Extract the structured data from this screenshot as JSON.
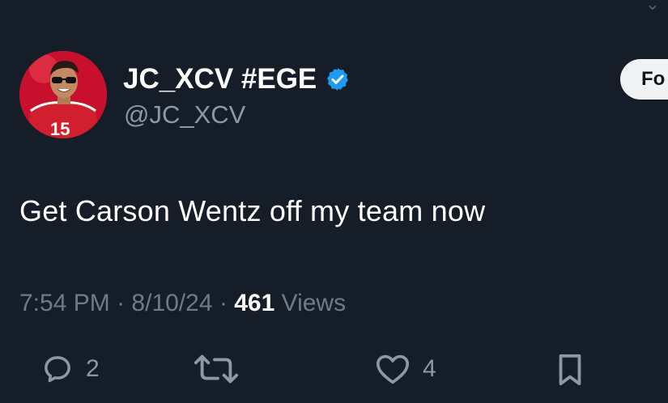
{
  "user": {
    "display_name": "JC_XCV #EGE",
    "handle": "@JC_XCV",
    "verified": true,
    "avatar_icon": "avatar-photo"
  },
  "follow_button": {
    "label": "Fo"
  },
  "tweet": {
    "text": "Get Carson Wentz off my team now"
  },
  "meta": {
    "time": "7:54 PM",
    "date": "8/10/24",
    "separator": "·",
    "views_count": "461",
    "views_label": "Views"
  },
  "actions": {
    "reply": {
      "icon": "reply-icon",
      "count": "2"
    },
    "retweet": {
      "icon": "retweet-icon",
      "count": ""
    },
    "like": {
      "icon": "heart-icon",
      "count": "4"
    },
    "bookmark": {
      "icon": "bookmark-icon",
      "count": ""
    }
  },
  "colors": {
    "background": "#151d28",
    "secondary_text": "#8b98a5",
    "verified_blue": "#1d9bf0",
    "avatar_red": "#c8102e"
  }
}
